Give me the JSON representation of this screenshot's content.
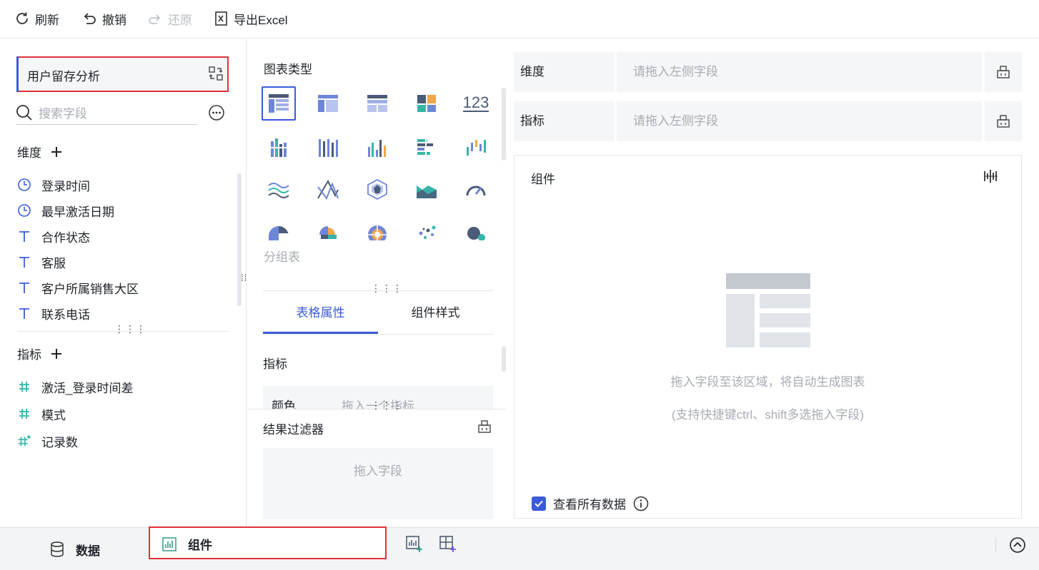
{
  "toolbar": {
    "refresh": "刷新",
    "undo": "撤销",
    "redo": "还原",
    "export": "导出Excel"
  },
  "left": {
    "dataset_name": "用户留存分析",
    "search_placeholder": "搜索字段",
    "dimensions_title": "维度",
    "dimensions": [
      {
        "icon": "clock-icon",
        "label": "登录时间"
      },
      {
        "icon": "clock-icon",
        "label": "最早激活日期"
      },
      {
        "icon": "text-type-icon",
        "label": "合作状态"
      },
      {
        "icon": "text-type-icon",
        "label": "客服"
      },
      {
        "icon": "text-type-icon",
        "label": "客户所属销售大区"
      },
      {
        "icon": "text-type-icon",
        "label": "联系电话"
      }
    ],
    "metrics_title": "指标",
    "metrics": [
      {
        "icon": "hash-icon",
        "label": "激活_登录时间差"
      },
      {
        "icon": "hash-icon",
        "label": "模式"
      },
      {
        "icon": "hash-star-icon",
        "label": "记录数"
      }
    ]
  },
  "middle": {
    "chart_type_title": "图表类型",
    "selected_chart_label": "分组表",
    "number_chart_glyph": "123",
    "tabs": [
      "表格属性",
      "组件样式"
    ],
    "metric_title": "指标",
    "color_label": "颜色",
    "color_placeholder": "拖入一个指标",
    "filter_title": "结果过滤器",
    "filter_placeholder": "拖入字段"
  },
  "right": {
    "dimension_label": "维度",
    "dimension_placeholder": "请拖入左侧字段",
    "metric_label": "指标",
    "metric_placeholder": "请拖入左侧字段",
    "component_title": "组件",
    "empty_hint": "拖入字段至该区域，将自动生成图表",
    "empty_sub_hint": "(支持快捷键ctrl、shift多选拖入字段)",
    "view_all_label": "查看所有数据",
    "view_all_checked": true
  },
  "bottom": {
    "data_tab": "数据",
    "component_tab": "组件"
  },
  "colors": {
    "accent": "#3b5bdb",
    "highlight_border": "#e0323a",
    "teal": "#35b5a9",
    "orange": "#f0a64a"
  }
}
